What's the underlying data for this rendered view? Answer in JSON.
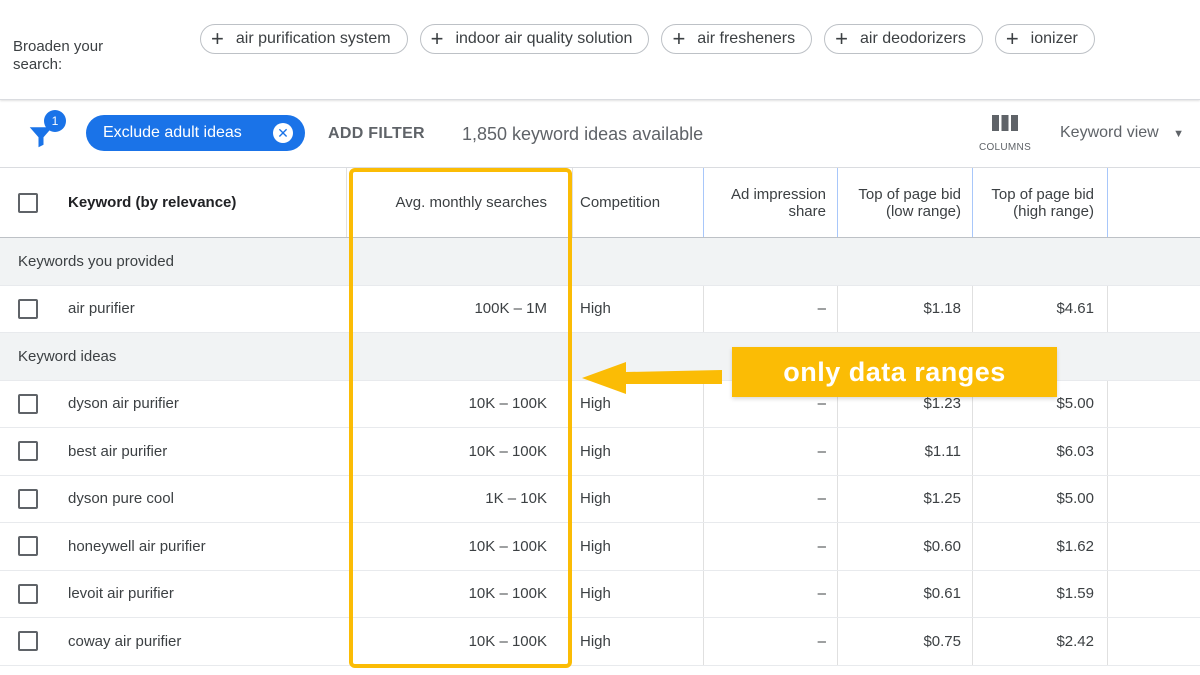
{
  "broaden": {
    "label": "Broaden your search:",
    "chips": [
      {
        "label": "air purification system"
      },
      {
        "label": "indoor air quality solution"
      },
      {
        "label": "air fresheners"
      },
      {
        "label": "air deodorizers"
      },
      {
        "label": "ionizer"
      }
    ]
  },
  "filterbar": {
    "filter_badge": "1",
    "exclude_chip": "Exclude adult ideas",
    "add_filter": "ADD FILTER",
    "ideas_count": "1,850 keyword ideas available",
    "columns_label": "COLUMNS",
    "keyword_view": "Keyword view"
  },
  "table": {
    "headers": {
      "keyword": "Keyword (by relevance)",
      "avg": "Avg. monthly searches",
      "competition": "Competition",
      "impression": "Ad impression share",
      "bid_low": "Top of page bid (low range)",
      "bid_high": "Top of page bid (high range)"
    },
    "group_provided": "Keywords you provided",
    "provided_rows": [
      {
        "keyword": "air purifier",
        "avg": "100K – 1M",
        "competition": "High",
        "impression": "–",
        "low": "$1.18",
        "high": "$4.61"
      }
    ],
    "group_ideas": "Keyword ideas",
    "idea_rows": [
      {
        "keyword": "dyson air purifier",
        "avg": "10K – 100K",
        "competition": "High",
        "impression": "–",
        "low": "$1.23",
        "high": "$5.00"
      },
      {
        "keyword": "best air purifier",
        "avg": "10K – 100K",
        "competition": "High",
        "impression": "–",
        "low": "$1.11",
        "high": "$6.03"
      },
      {
        "keyword": "dyson pure cool",
        "avg": "1K – 10K",
        "competition": "High",
        "impression": "–",
        "low": "$1.25",
        "high": "$5.00"
      },
      {
        "keyword": "honeywell air purifier",
        "avg": "10K – 100K",
        "competition": "High",
        "impression": "–",
        "low": "$0.60",
        "high": "$1.62"
      },
      {
        "keyword": "levoit air purifier",
        "avg": "10K – 100K",
        "competition": "High",
        "impression": "–",
        "low": "$0.61",
        "high": "$1.59"
      },
      {
        "keyword": "coway air purifier",
        "avg": "10K – 100K",
        "competition": "High",
        "impression": "–",
        "low": "$0.75",
        "high": "$2.42"
      }
    ]
  },
  "annotation": {
    "label": "only data ranges",
    "color": "#fbbc05"
  },
  "colors": {
    "accent": "#1a73e8",
    "highlight": "#fbbc05"
  }
}
